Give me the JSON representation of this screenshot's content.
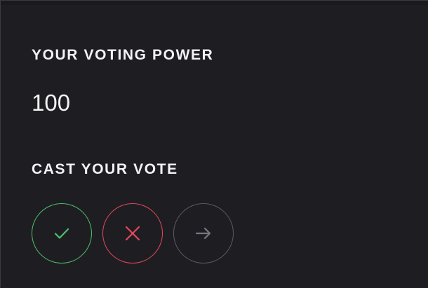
{
  "voting_power": {
    "label": "YOUR VOTING POWER",
    "value": "100"
  },
  "cast_vote": {
    "label": "CAST YOUR VOTE",
    "options": [
      {
        "name": "yes",
        "icon": "check-icon",
        "color": "#4fbf6e"
      },
      {
        "name": "no",
        "icon": "close-icon",
        "color": "#e5485c"
      },
      {
        "name": "abstain",
        "icon": "arrow-right-icon",
        "color": "#5a5a63"
      }
    ]
  },
  "colors": {
    "background": "#1e1e22",
    "text": "#f2f2f4",
    "yes": "#4fbf6e",
    "no": "#e5485c",
    "neutral": "#5a5a63",
    "neutral_icon": "#77777f"
  }
}
